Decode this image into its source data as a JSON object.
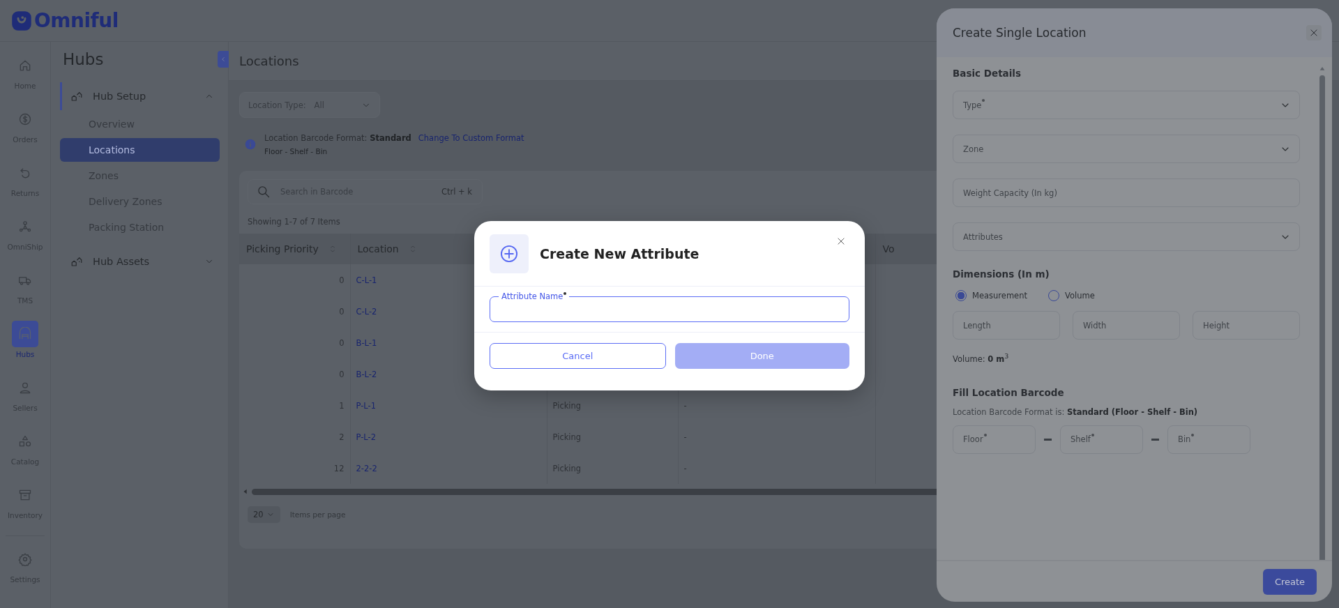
{
  "brand": {
    "name": "Omniful"
  },
  "rail": {
    "items": [
      {
        "label": "Home",
        "selected": false
      },
      {
        "label": "Orders",
        "selected": false
      },
      {
        "label": "Returns",
        "selected": false
      },
      {
        "label": "OmniShip",
        "selected": false
      },
      {
        "label": "TMS",
        "selected": false
      },
      {
        "label": "Hubs",
        "selected": true
      },
      {
        "label": "Sellers",
        "selected": false
      },
      {
        "label": "Catalog",
        "selected": false
      },
      {
        "label": "Inventory",
        "selected": false
      }
    ],
    "footer_items": [
      {
        "label": "Settings",
        "selected": false
      }
    ]
  },
  "nav": {
    "title": "Hubs",
    "groups": [
      {
        "label": "Hub Setup",
        "expanded": true,
        "selected": true,
        "children": [
          {
            "label": "Overview",
            "selected": false
          },
          {
            "label": "Locations",
            "selected": true
          },
          {
            "label": "Zones",
            "selected": false
          },
          {
            "label": "Delivery Zones",
            "selected": false
          },
          {
            "label": "Packing Station",
            "selected": false
          }
        ]
      },
      {
        "label": "Hub Assets",
        "expanded": false,
        "selected": false
      }
    ]
  },
  "page": {
    "title": "Locations",
    "filter": {
      "label": "Location Type:",
      "value": "All"
    },
    "barcode_info": {
      "text": "Location Barcode Format: **Standard**",
      "link": "Change To Custom Format",
      "detail": "Floor - Shelf - Bin"
    },
    "search": {
      "placeholder": "Search in Barcode",
      "shortcut": "Ctrl + k"
    },
    "summary": "Showing 1-7 of 7 Items",
    "table": {
      "columns": [
        {
          "label": "Picking Priority",
          "sortable": true
        },
        {
          "label": "Location",
          "sortable": true
        },
        {},
        {},
        {
          "label": "Vo",
          "sortable": false
        }
      ],
      "rows": [
        {
          "cells": [
            "0",
            "C-L-1"
          ]
        },
        {
          "cells": [
            "0",
            "C-L-2"
          ]
        },
        {
          "cells": [
            "0",
            "B-L-1"
          ]
        },
        {
          "cells": [
            "0",
            "B-L-2"
          ]
        },
        {
          "cells": [
            "1",
            "P-L-1",
            "Picking",
            "-"
          ]
        },
        {
          "cells": [
            "2",
            "P-L-2",
            "Picking",
            "-"
          ]
        },
        {
          "cells": [
            "12",
            "2-2-2",
            "Picking",
            "-"
          ]
        }
      ]
    },
    "pagination": {
      "page_size": "20",
      "label": "Items per page"
    }
  },
  "drawer": {
    "title": "Create Single Location",
    "sections": [
      {
        "kind": "fields",
        "title": "Basic Details",
        "fields": [
          {
            "kind": "select",
            "placeholder": "Type",
            "required": true
          },
          {
            "kind": "select",
            "placeholder": "Zone",
            "required": false
          },
          {
            "kind": "input",
            "placeholder": "Weight Capacity (In kg)",
            "required": false
          },
          {
            "kind": "select",
            "placeholder": "Attributes",
            "required": false
          }
        ]
      },
      {
        "kind": "dimensions",
        "title": "Dimensions (In m)",
        "options": [
          {
            "label": "Measurement",
            "selected": true
          },
          {
            "label": "Volume",
            "selected": false
          }
        ],
        "fields": [
          {
            "kind": "input",
            "placeholder": "Length",
            "required": false
          },
          {
            "kind": "input",
            "placeholder": "Width",
            "required": false
          },
          {
            "kind": "input",
            "placeholder": "Height",
            "required": false
          }
        ],
        "result": "Volume: **0 m**$^{3}$"
      },
      {
        "kind": "barcode",
        "title": "Fill Location Barcode",
        "note": "Location Barcode Format is: **Standard (Floor - Shelf - Bin)**",
        "fields": [
          {
            "kind": "input",
            "placeholder": "Floor",
            "required": true
          },
          {
            "kind": "input",
            "placeholder": "Shelf",
            "required": true
          },
          {
            "kind": "input",
            "placeholder": "Bin",
            "required": true
          }
        ]
      }
    ],
    "submit": "Create"
  },
  "modal": {
    "title": "Create New Attribute",
    "field": {
      "label": "Attribute Name",
      "required": true,
      "focused": true
    },
    "buttons": [
      {
        "label": "Cancel",
        "kind": "secondary",
        "disabled": false
      },
      {
        "label": "Done",
        "kind": "primary",
        "disabled": true
      }
    ]
  }
}
